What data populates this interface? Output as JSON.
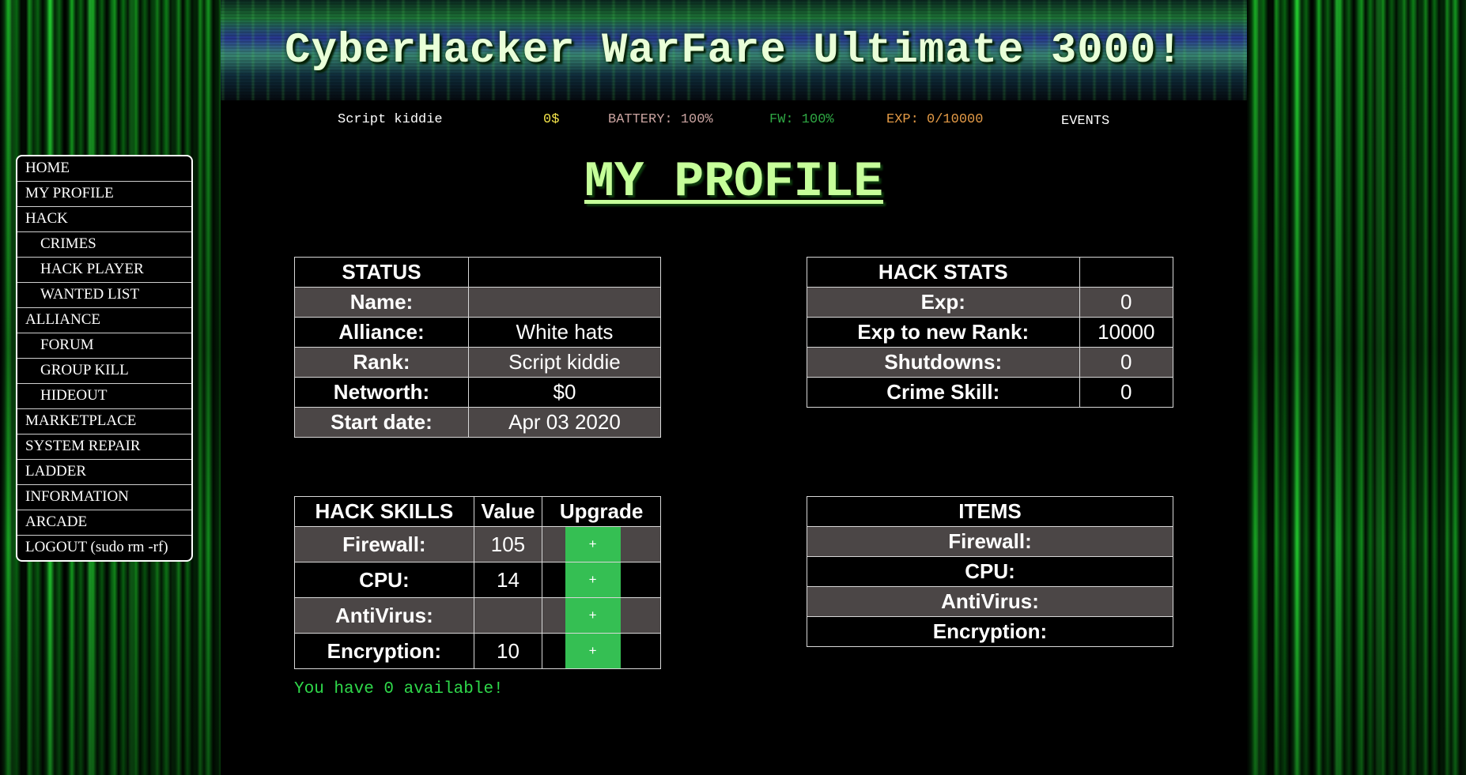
{
  "banner": {
    "title": "CyberHacker WarFare Ultimate 3000!"
  },
  "statusbar": {
    "rank": "Script kiddie",
    "money": "0$",
    "battery": "BATTERY: 100%",
    "fw": "FW: 100%",
    "exp": "EXP: 0/10000",
    "events": "EVENTS"
  },
  "menu": {
    "items": [
      {
        "label": "HOME",
        "sub": false
      },
      {
        "label": "MY PROFILE",
        "sub": false
      },
      {
        "label": "HACK",
        "sub": false
      },
      {
        "label": "CRIMES",
        "sub": true
      },
      {
        "label": "HACK PLAYER",
        "sub": true
      },
      {
        "label": "WANTED LIST",
        "sub": true
      },
      {
        "label": "ALLIANCE",
        "sub": false
      },
      {
        "label": "FORUM",
        "sub": true
      },
      {
        "label": "GROUP KILL",
        "sub": true
      },
      {
        "label": "HIDEOUT",
        "sub": true
      },
      {
        "label": "MARKETPLACE",
        "sub": false
      },
      {
        "label": "SYSTEM REPAIR",
        "sub": false
      },
      {
        "label": "LADDER",
        "sub": false
      },
      {
        "label": "INFORMATION",
        "sub": false
      },
      {
        "label": "ARCADE",
        "sub": false
      },
      {
        "label": "LOGOUT (sudo rm -rf)",
        "sub": false
      }
    ]
  },
  "page": {
    "title": "MY PROFILE"
  },
  "status": {
    "header": "STATUS",
    "rows": [
      {
        "label": "Name:",
        "value": ""
      },
      {
        "label": "Alliance:",
        "value": "White hats"
      },
      {
        "label": "Rank:",
        "value": "Script kiddie"
      },
      {
        "label": "Networth:",
        "value": "$0"
      },
      {
        "label": "Start date:",
        "value": "Apr 03 2020"
      }
    ]
  },
  "hack_stats": {
    "header": "HACK STATS",
    "rows": [
      {
        "label": "Exp:",
        "value": "0"
      },
      {
        "label": "Exp to new Rank:",
        "value": "10000"
      },
      {
        "label": "Shutdowns:",
        "value": "0"
      },
      {
        "label": "Crime Skill:",
        "value": "0"
      }
    ]
  },
  "hack_skills": {
    "header": "HACK SKILLS",
    "value_header": "Value",
    "upgrade_header": "Upgrade",
    "upgrade_label": "+",
    "rows": [
      {
        "label": "Firewall:",
        "value": "105"
      },
      {
        "label": "CPU:",
        "value": "14"
      },
      {
        "label": "AntiVirus:",
        "value": ""
      },
      {
        "label": "Encryption:",
        "value": "10"
      }
    ],
    "available_text": "You have 0 available!"
  },
  "items": {
    "header": "ITEMS",
    "rows": [
      {
        "label": "Firewall:"
      },
      {
        "label": "CPU:"
      },
      {
        "label": "AntiVirus:"
      },
      {
        "label": "Encryption:"
      }
    ]
  },
  "colors": {
    "accent_green": "#35bf53",
    "title_green": "#c6ff9a",
    "alt_row": "#4b4646",
    "money_yellow": "#f3e34a",
    "exp_orange": "#e39a46"
  }
}
